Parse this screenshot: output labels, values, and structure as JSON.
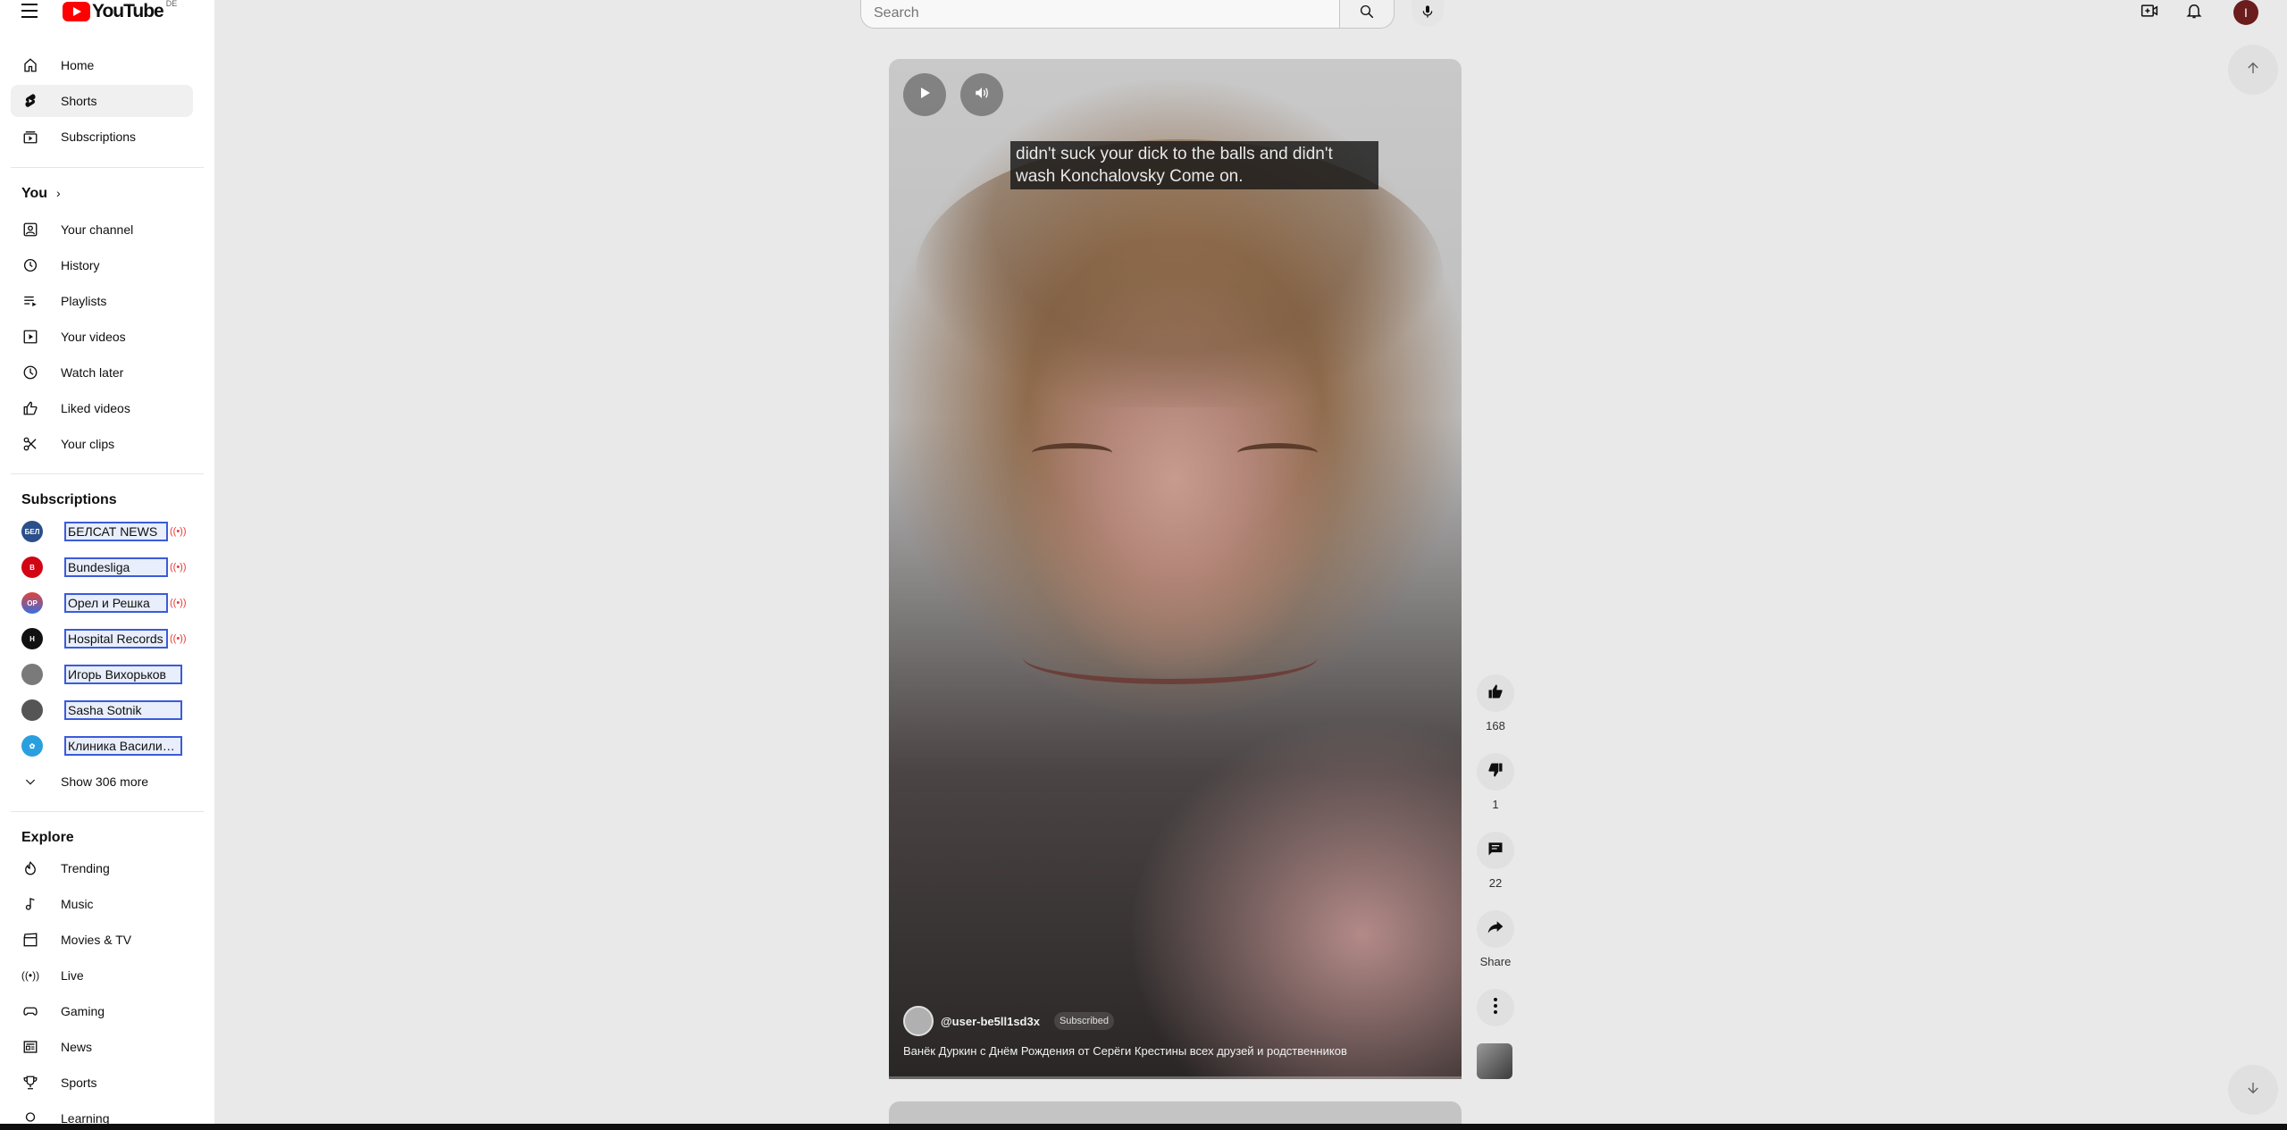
{
  "header": {
    "logo_text": "YouTube",
    "country_code": "DE",
    "search_placeholder": "Search",
    "profile_initial": "I"
  },
  "sidebar": {
    "main": [
      {
        "label": "Home",
        "icon": "home-icon"
      },
      {
        "label": "Shorts",
        "icon": "shorts-icon"
      },
      {
        "label": "Subscriptions",
        "icon": "subscriptions-icon"
      }
    ],
    "you_title": "You",
    "you": [
      {
        "label": "Your channel"
      },
      {
        "label": "History"
      },
      {
        "label": "Playlists"
      },
      {
        "label": "Your videos"
      },
      {
        "label": "Watch later"
      },
      {
        "label": "Liked videos"
      },
      {
        "label": "Your clips"
      }
    ],
    "subscriptions_title": "Subscriptions",
    "subscriptions": [
      {
        "name": "БЕЛСАТ NEWS",
        "live": true,
        "color": "#2a4f8a"
      },
      {
        "name": "Bundesliga",
        "live": true,
        "color": "#d20515"
      },
      {
        "name": "Орел и Решка",
        "live": true,
        "color": "#e0413a"
      },
      {
        "name": "Hospital Records",
        "live": true,
        "color": "#111111"
      },
      {
        "name": "Игорь Вихорьков",
        "live": false,
        "color": "#7a7a7a"
      },
      {
        "name": "Sasha Sotnik",
        "live": false,
        "color": "#555555"
      },
      {
        "name": "Клиника Василия…",
        "live": false,
        "color": "#2a9fe0"
      }
    ],
    "show_more": "Show 306 more",
    "explore_title": "Explore",
    "explore": [
      {
        "label": "Trending"
      },
      {
        "label": "Music"
      },
      {
        "label": "Movies & TV"
      },
      {
        "label": "Live"
      },
      {
        "label": "Gaming"
      },
      {
        "label": "News"
      },
      {
        "label": "Sports"
      },
      {
        "label": "Learning"
      }
    ]
  },
  "video": {
    "caption": "didn't suck your dick to the balls and didn't wash Konchalovsky Come on.",
    "channel": "@user-be5ll1sd3x",
    "subscribed_label": "Subscribed",
    "description": "Ванёк Дуркин с Днём Рождения от Серёги Крестины всех друзей и родственников",
    "progress": 0.0
  },
  "actions": {
    "likes": "168",
    "dislikes": "1",
    "comments": "22",
    "share": "Share"
  }
}
